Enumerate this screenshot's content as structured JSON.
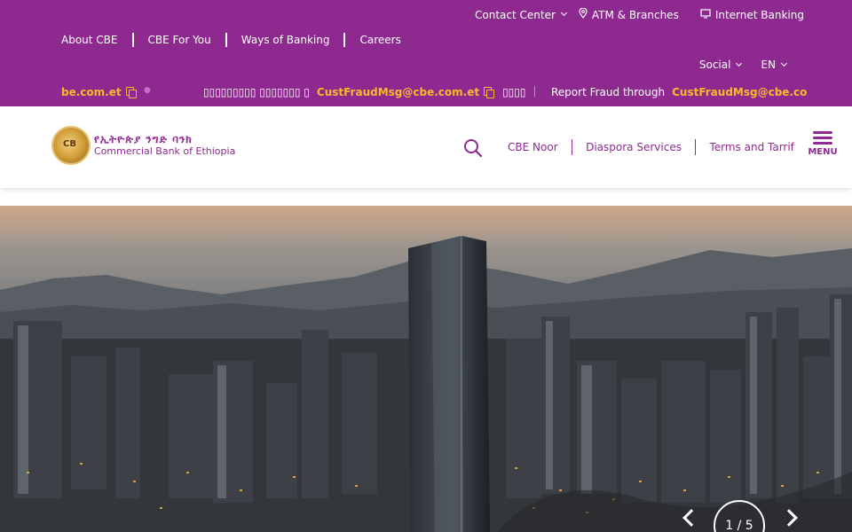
{
  "topbar": {
    "contact_center": "Contact Center",
    "atm_branches": "ATM & Branches",
    "internet_banking": "Internet Banking",
    "nav": [
      "About CBE",
      "CBE For You",
      "Ways of Banking",
      "Careers"
    ],
    "social": "Social",
    "language": "EN",
    "ticker": {
      "email_partial": "be.com.et",
      "notice_amharic": "▯▯▯▯▯▯▯▯▯ ▯▯▯▯▯▯▯ ▯",
      "email": "CustFraudMsg@cbe.com.et",
      "notice_amharic_end": "▯▯▯▯",
      "report_label": "Report Fraud through",
      "report_email": "CustFraudMsg@cbe.co"
    }
  },
  "header": {
    "logo_amharic": "የኢትዮጵያ ንግድ ባንክ",
    "logo_english": "Commercial Bank of Ethiopia",
    "links": [
      "CBE Noor",
      "Diaspora Services",
      "Terms and Tarrif"
    ],
    "menu_label": "MENU"
  },
  "hero": {
    "slide_counter": "1 / 5"
  },
  "colors": {
    "brand_purple": "#8e2a8f",
    "accent_yellow": "#f5bb2e"
  },
  "icons": [
    "location-pin-icon",
    "monitor-icon",
    "copy-icon",
    "search-icon",
    "hamburger-menu-icon",
    "chevron-down-icon",
    "arrow-left-icon",
    "arrow-right-icon"
  ]
}
